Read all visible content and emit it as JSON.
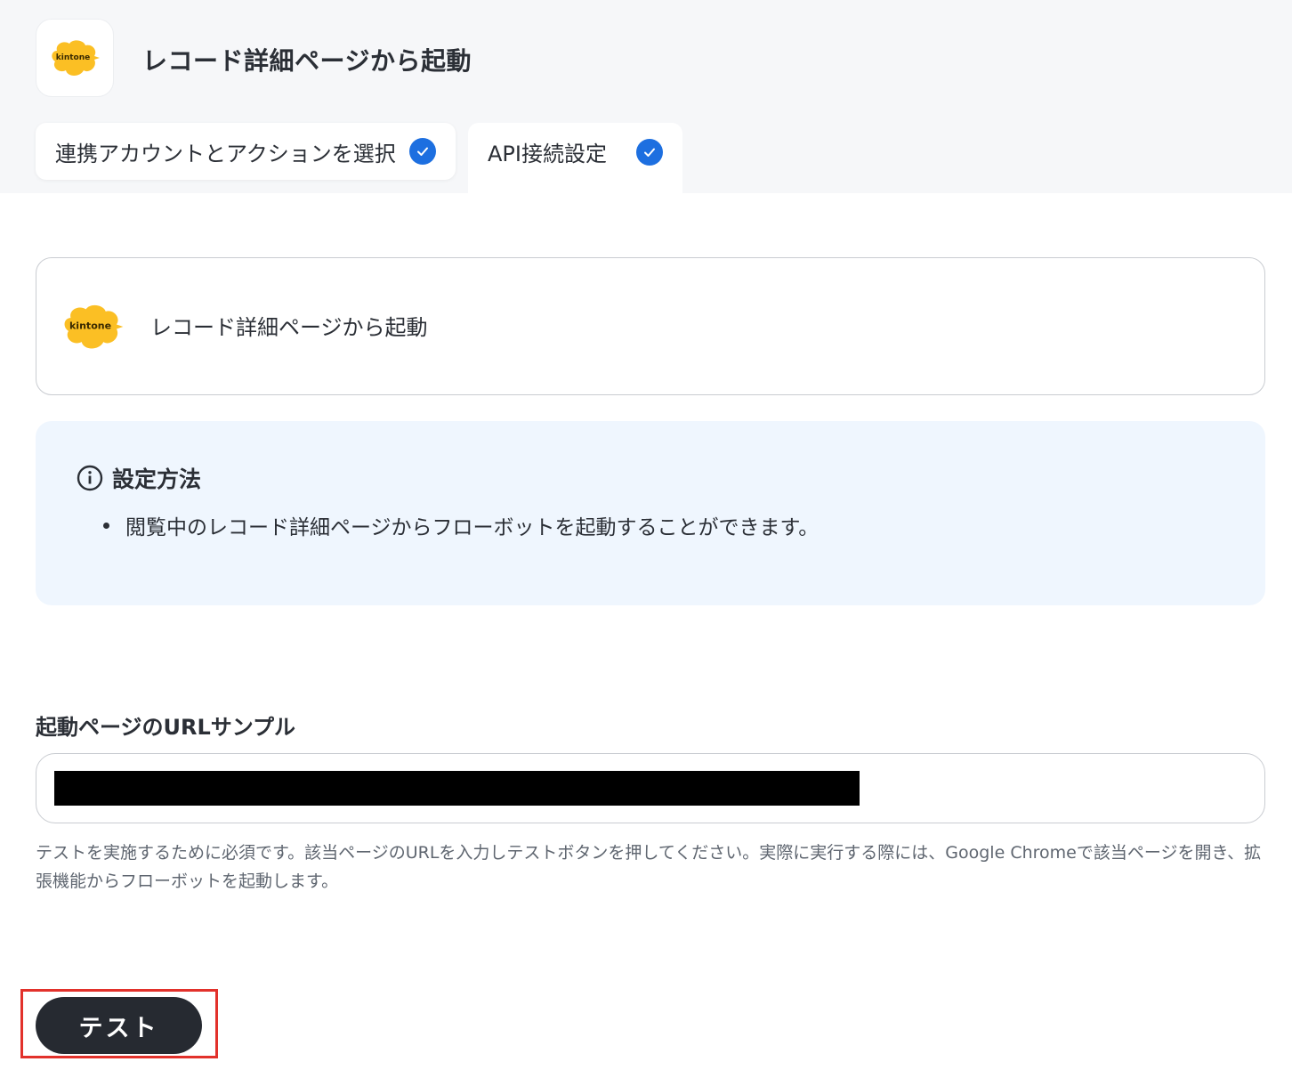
{
  "header": {
    "logo_text": "kintone",
    "title": "レコード詳細ページから起動"
  },
  "tabs": [
    {
      "label": "連携アカウントとアクションを選択",
      "completed": true
    },
    {
      "label": "API接続設定",
      "completed": true
    }
  ],
  "action_card": {
    "logo_text": "kintone",
    "label": "レコード詳細ページから起動"
  },
  "info": {
    "title": "設定方法",
    "items": [
      "閲覧中のレコード詳細ページからフローボットを起動することができます。"
    ]
  },
  "url_field": {
    "label": "起動ページのURLサンプル",
    "help": "テストを実施するために必須です。該当ページのURLを入力しテストボタンを押してください。実際に実行する際には、Google Chromeで該当ページを開き、拡張機能からフローボットを起動します。"
  },
  "test_button": {
    "label": "テスト"
  },
  "colors": {
    "accent": "#1d6fe0",
    "kintone_yellow": "#fbbf24",
    "highlight": "#e2312b",
    "info_bg": "#eff6fe"
  }
}
